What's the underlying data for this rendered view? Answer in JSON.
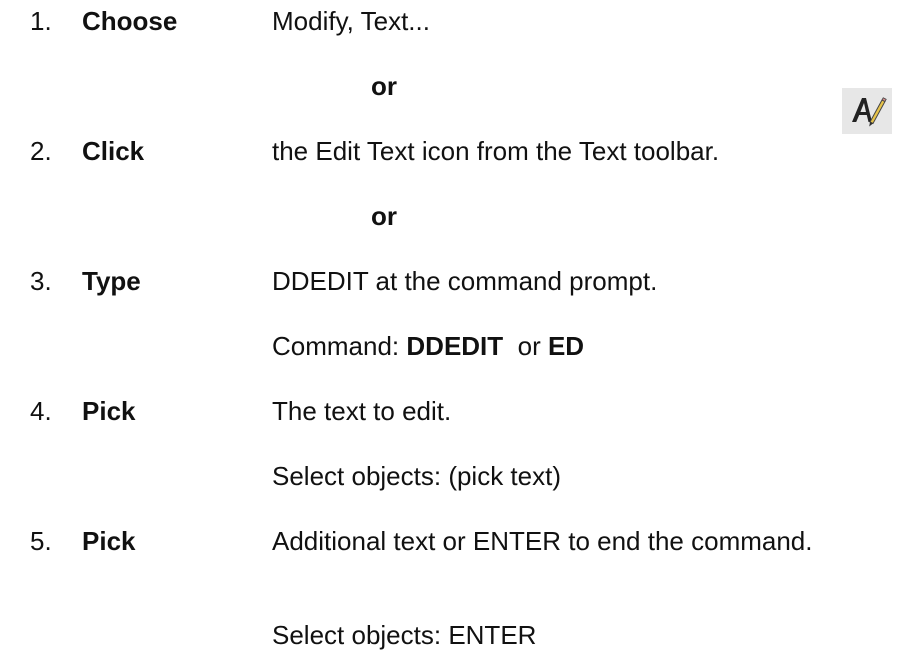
{
  "steps": [
    {
      "num": "1.",
      "verb": "Choose",
      "desc": "Modify, Text..."
    },
    {
      "num": "2.",
      "verb": "Click",
      "desc": "the Edit Text icon from the Text toolbar."
    },
    {
      "num": "3.",
      "verb": "Type",
      "desc": "DDEDIT at the command prompt."
    },
    {
      "num": "4.",
      "verb": "Pick",
      "desc": "The text to edit."
    },
    {
      "num": "5.",
      "verb": "Pick",
      "desc": "Additional text or ENTER to end the command."
    }
  ],
  "or_1": "or",
  "or_2": "or",
  "command_line": {
    "prefix": "Command: ",
    "cmd1": "DDEDIT",
    "mid": "  or ",
    "cmd2": "ED"
  },
  "select_objects_1": "Select objects: (pick text)",
  "select_objects_2": "Select objects: ENTER",
  "edit_text_icon": "edit-text-icon"
}
